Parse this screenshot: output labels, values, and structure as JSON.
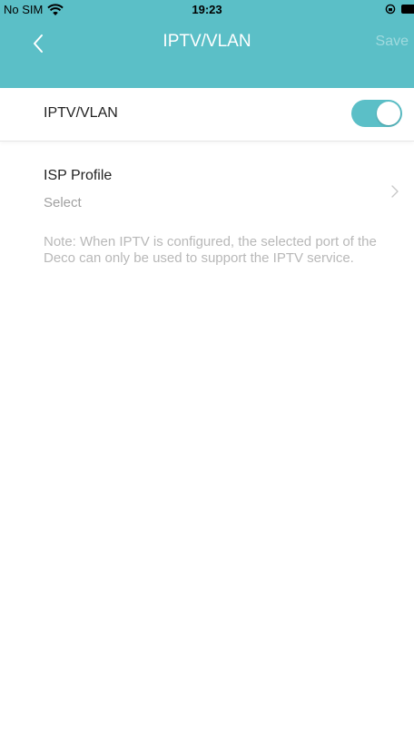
{
  "status_bar": {
    "carrier": "No SIM",
    "time": "19:23"
  },
  "nav": {
    "title": "IPTV/VLAN",
    "save_label": "Save"
  },
  "iptv_toggle": {
    "label": "IPTV/VLAN",
    "enabled": true
  },
  "isp_profile": {
    "label": "ISP Profile",
    "value": "Select"
  },
  "note": "Note: When IPTV is configured, the selected port of the Deco can only be used to support the IPTV service.",
  "colors": {
    "accent": "#5bbfc7",
    "muted_text": "#b8b8b8"
  },
  "icons": [
    "wifi-icon",
    "lock-rotation-icon",
    "battery-icon",
    "back-chevron-icon",
    "chevron-right-icon"
  ]
}
